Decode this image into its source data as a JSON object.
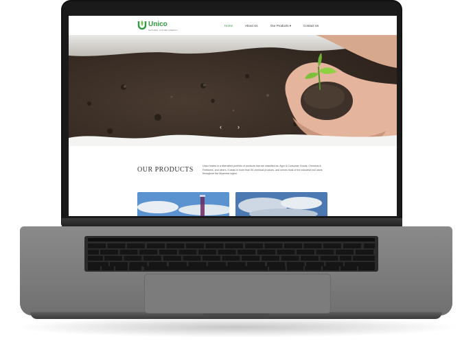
{
  "brand": {
    "name": "Unico",
    "tagline": "NATURAL & PURE ENERGY",
    "color": "#2e9a3d"
  },
  "nav": {
    "items": [
      {
        "label": "Home",
        "active": true
      },
      {
        "label": "About Us"
      },
      {
        "label": "Our Products ▾"
      },
      {
        "label": "Contact Us"
      }
    ]
  },
  "hero": {
    "prev_icon": "chevron-left-icon",
    "next_icon": "chevron-right-icon",
    "prev_glyph": "‹",
    "next_glyph": "›"
  },
  "products": {
    "title": "OUR PRODUCTS",
    "description": "Unico trades in a diversified portfolio of products that are classified as, Agro & Consumer Goods, Chemical & Fertilizers, and others. It deals in more than 50 chemical products, and serves most of the industrial end users throughout the Myanmar region."
  }
}
